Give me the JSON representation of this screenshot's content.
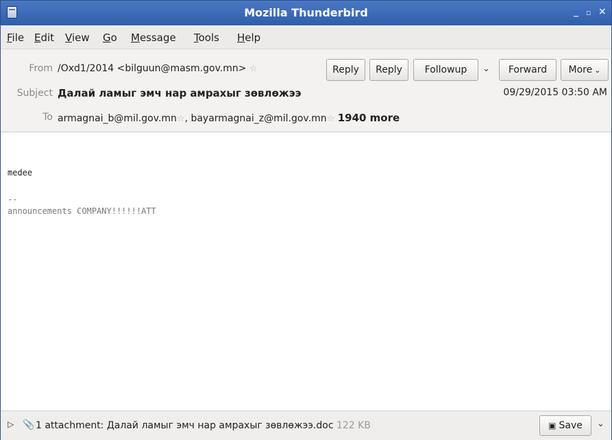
{
  "window": {
    "title": "Mozilla Thunderbird",
    "minimize_glyph": "‗",
    "maximize_glyph": "▫",
    "close_glyph": "×"
  },
  "menubar": {
    "items": [
      {
        "label": "File",
        "mnemonic": "F"
      },
      {
        "label": "Edit",
        "mnemonic": "E"
      },
      {
        "label": "View",
        "mnemonic": "V"
      },
      {
        "label": "Go",
        "mnemonic": "G"
      },
      {
        "label": "Message",
        "mnemonic": "M"
      },
      {
        "label": "Tools",
        "mnemonic": "T"
      },
      {
        "label": "Help",
        "mnemonic": "H"
      }
    ]
  },
  "header": {
    "from_label": "From",
    "from_value": "/Oxd1/2014 <bilguun@masm.gov.mn>",
    "subject_label": "Subject",
    "subject_value": "Далай ламыг эмч нар амрахыг зөвлөжээ",
    "date": "09/29/2015 03:50 AM",
    "to_label": "To",
    "to_recipient_1": "armagnai_b@mil.gov.mn",
    "to_separator": ",",
    "to_recipient_2": "bayarmagnai_z@mil.gov.mn",
    "more_recipients": "1940 more",
    "buttons": {
      "reply": "Reply",
      "reply_all": "Reply",
      "followup": "Followup",
      "followup_menu": "⌄",
      "forward": "Forward",
      "more": "More"
    }
  },
  "body": {
    "line1": "medee",
    "signature_sep": "--",
    "signature": "announcements COMPANY!!!!!!ATT"
  },
  "attachments": {
    "summary": "1 attachment: Далай ламыг эмч нар амрахыг зөвлөжээ.doc",
    "size": "122 KB",
    "save_label": "Save"
  },
  "colors": {
    "titlebar": "#3a68b8",
    "header_bg": "#f3f2f0",
    "label_gray": "#8a8a8a"
  }
}
